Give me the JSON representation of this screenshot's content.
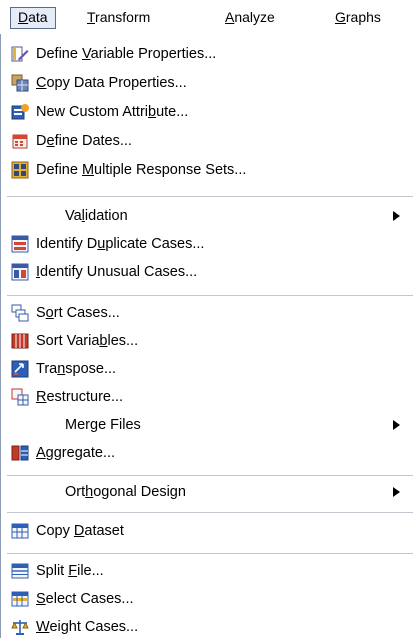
{
  "menubar": {
    "items": [
      {
        "pre": "",
        "ul": "D",
        "post": "ata"
      },
      {
        "pre": "",
        "ul": "T",
        "post": "ransform"
      },
      {
        "pre": "",
        "ul": "A",
        "post": "nalyze"
      },
      {
        "pre": "",
        "ul": "G",
        "post": "raphs"
      }
    ]
  },
  "menu": {
    "items": [
      {
        "pre": "Define ",
        "ul": "V",
        "post": "ariable Properties..."
      },
      {
        "pre": "",
        "ul": "C",
        "post": "opy Data Properties..."
      },
      {
        "pre": "New Custom Attri",
        "ul": "b",
        "post": "ute..."
      },
      {
        "pre": "D",
        "ul": "e",
        "post": "fine Dates..."
      },
      {
        "pre": "Define ",
        "ul": "M",
        "post": "ultiple Response Sets..."
      },
      {
        "pre": "Va",
        "ul": "l",
        "post": "idation"
      },
      {
        "pre": "Identify D",
        "ul": "u",
        "post": "plicate Cases..."
      },
      {
        "pre": "",
        "ul": "I",
        "post": "dentify Unusual Cases..."
      },
      {
        "pre": "S",
        "ul": "o",
        "post": "rt Cases..."
      },
      {
        "pre": "Sort Varia",
        "ul": "b",
        "post": "les..."
      },
      {
        "pre": "Tra",
        "ul": "n",
        "post": "spose..."
      },
      {
        "pre": "",
        "ul": "R",
        "post": "estructure..."
      },
      {
        "pre": "Mer",
        "ul": "g",
        "post": "e Files"
      },
      {
        "pre": "",
        "ul": "A",
        "post": "ggregate..."
      },
      {
        "pre": "Ort",
        "ul": "h",
        "post": "ogonal Design"
      },
      {
        "pre": "Copy ",
        "ul": "D",
        "post": "ataset"
      },
      {
        "pre": "Split ",
        "ul": "F",
        "post": "ile..."
      },
      {
        "pre": "",
        "ul": "S",
        "post": "elect Cases..."
      },
      {
        "pre": "",
        "ul": "W",
        "post": "eight Cases..."
      }
    ]
  }
}
